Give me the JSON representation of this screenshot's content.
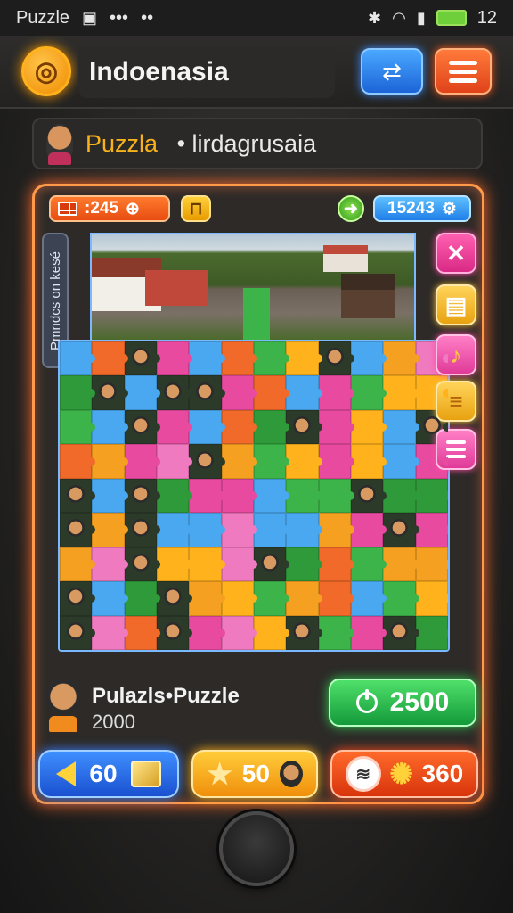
{
  "statusbar": {
    "app_name": "Puzzle",
    "dots": "•••",
    "dots2": "••",
    "battery_level": "12",
    "icons": [
      "image-icon",
      "bluetooth-icon",
      "wifi-icon",
      "signal-icon",
      "battery-icon"
    ]
  },
  "header": {
    "title": "Indoenasia",
    "logo_icon": "coin-logo-icon",
    "translate_icon": "translate-icon",
    "menu_icon": "hamburger-menu-icon"
  },
  "subbar": {
    "accent": "Puzzla",
    "text": "• lirdagrusaia"
  },
  "stats": {
    "score": ":245",
    "points": "15243"
  },
  "side_tab": {
    "label": "Pmndcs on kesé"
  },
  "tools": [
    "close-icon",
    "layers-icon",
    "bell-icon",
    "stack-icon",
    "list-icon"
  ],
  "player": {
    "name": "Pulazls•Puzzle",
    "score": "2000"
  },
  "coin_button": {
    "value": "2500"
  },
  "bottom_buttons": {
    "back_value": "60",
    "star_value": "50",
    "sun_value": "360"
  },
  "colors": {
    "frame_glow": "#ff9a4a",
    "accent": "#f7b21b",
    "green": "#149a3a",
    "blue": "#1a50d0"
  }
}
